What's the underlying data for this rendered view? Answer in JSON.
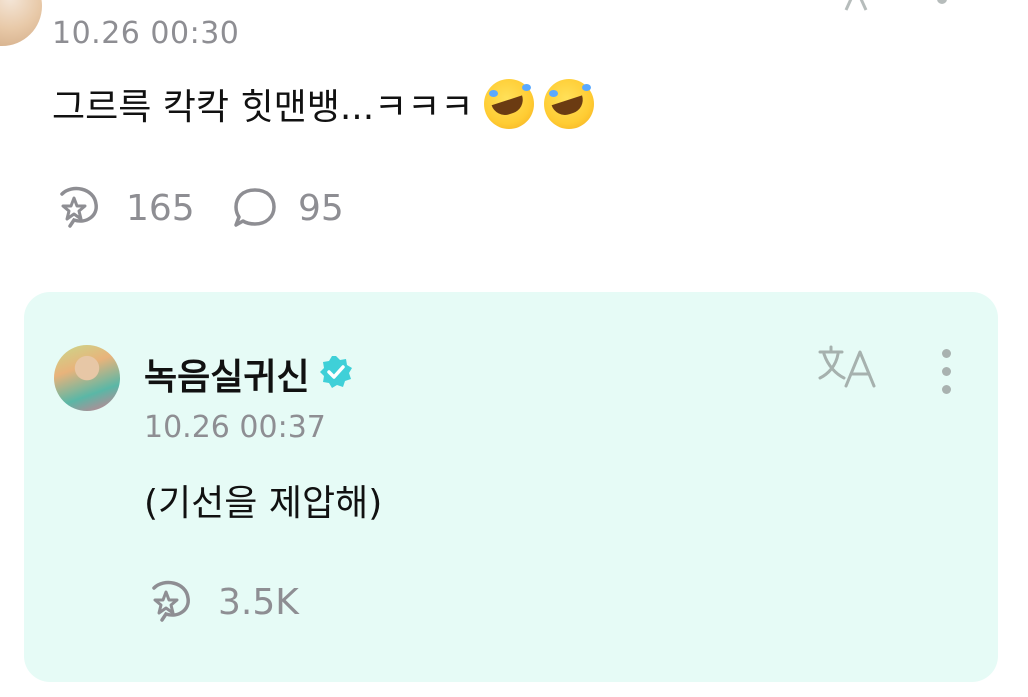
{
  "top_post": {
    "timestamp": "10.26 00:30",
    "text": "그르륵 칵칵 힛맨뱅...ㅋㅋㅋ",
    "emoji_count": 2,
    "emoji_name": "rolling-on-the-floor-laughing",
    "repost_count": "165",
    "comment_count": "95"
  },
  "reply": {
    "author": "녹음실귀신",
    "verified": true,
    "timestamp": "10.26 00:37",
    "text": "(기선을 제압해)",
    "repost_count": "3.5K"
  },
  "colors": {
    "card_bg": "#e6fbf6",
    "verified": "#3fd0d8",
    "meta_text": "#8e8e93",
    "icon": "#8e8e93"
  }
}
